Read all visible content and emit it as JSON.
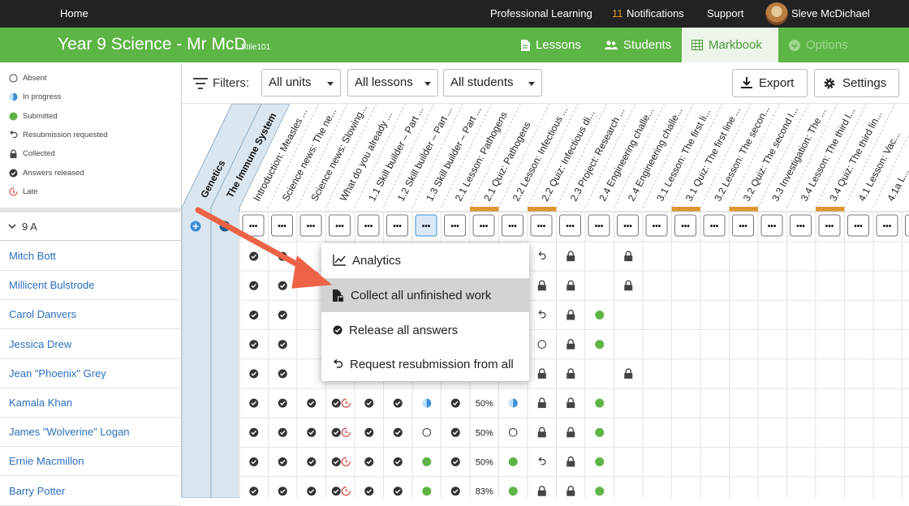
{
  "topbar": {
    "home": "Home",
    "professional_learning": "Professional Learning",
    "notifications_count": "11",
    "notifications": "Notifications",
    "support": "Support",
    "user_name": "Sleve McDichael"
  },
  "classbar": {
    "title": "Year 9 Science - Mr McD",
    "code": "Stile101",
    "tabs": [
      "Lessons",
      "Students",
      "Markbook",
      "Options"
    ],
    "active_tab": "Markbook"
  },
  "legend": [
    "Absent",
    "In progress",
    "Submitted",
    "Resubmission requested",
    "Collected",
    "Answers released",
    "Late"
  ],
  "filters": {
    "label": "Filters:",
    "units": "All units",
    "lessons": "All lessons",
    "students": "All students",
    "export": "Export",
    "settings": "Settings"
  },
  "units": [
    "Genetics",
    "The Immune System"
  ],
  "lessons": [
    "Introduction: Measles ...",
    "Science news: The ne...",
    "Science news: Slowing...",
    "What do you already ...",
    "1.1 Skill builder – Part ...",
    "1.2 Skill builder – Part ...",
    "1.3 Skill builder – Part ...",
    "2.1 Lesson: Pathogens",
    "2.1 Quiz: Pathogens",
    "2.2 Lesson: Infectious ...",
    "2.2 Quiz: Infectious di...",
    "2.3 Project: Research ...",
    "2.4 Engineering challe...",
    "2.4 Engineering challe...",
    "3.1 Lesson: The first li...",
    "3.1 Quiz: The first line ...",
    "3.2 Lesson: The secon...",
    "3.2 Quiz: The second l...",
    "3.3 Investigation: The ...",
    "3.4 Lesson: The third l...",
    "3.4 Quiz: The third lin...",
    "4.1 Lesson: Vac...",
    "4.1a L..."
  ],
  "class_group": "9 A",
  "students": [
    "Mitch Bott",
    "Millicent Bulstrode",
    "Carol Danvers",
    "Jessica Drew",
    "Jean \"Phoenix\" Grey",
    "Kamala Khan",
    "James \"Wolverine\" Logan",
    "Ernie Macmillon",
    "Barry Potter"
  ],
  "menu": {
    "analytics": "Analytics",
    "collect": "Collect all unfinished work",
    "release": "Release all answers",
    "resubmit": "Request resubmission from all"
  },
  "more_label": "•••",
  "marks": [
    [
      "R",
      "R",
      "",
      "",
      "",
      "",
      "",
      "",
      "",
      "",
      "U",
      "L",
      "",
      "L"
    ],
    [
      "R",
      "R",
      "",
      "",
      "",
      "",
      "",
      "",
      "",
      "",
      "L",
      "L",
      "",
      "L"
    ],
    [
      "R",
      "R",
      "",
      "",
      "",
      "",
      "",
      "",
      "",
      "",
      "U",
      "L",
      "S",
      ""
    ],
    [
      "R",
      "R",
      "",
      "",
      "",
      "",
      "",
      "",
      "",
      "",
      "A",
      "L",
      "S",
      ""
    ],
    [
      "R",
      "R",
      "",
      "",
      "",
      "",
      "",
      "",
      "",
      "",
      "L",
      "L",
      "",
      "L"
    ],
    [
      "R",
      "R",
      "R",
      "RL",
      "R",
      "R",
      "H",
      "R",
      "50%",
      "H",
      "L",
      "L",
      "S",
      ""
    ],
    [
      "R",
      "R",
      "R",
      "RL",
      "R",
      "R",
      "A",
      "R",
      "50%",
      "A",
      "L",
      "L",
      "S",
      ""
    ],
    [
      "R",
      "R",
      "R",
      "RL",
      "R",
      "R",
      "S",
      "R",
      "50%",
      "S",
      "U",
      "L",
      "S",
      ""
    ],
    [
      "R",
      "R",
      "R",
      "RL",
      "R",
      "R",
      "S",
      "R",
      "83%",
      "S",
      "L",
      "L",
      "S",
      ""
    ]
  ],
  "colors": {
    "green": "#5db545",
    "orange": "#e0962e",
    "blue": "#3a8ed6",
    "late": "#d9534f",
    "lightblue_band": "#dbe7f0",
    "link": "#2a6fbb"
  }
}
